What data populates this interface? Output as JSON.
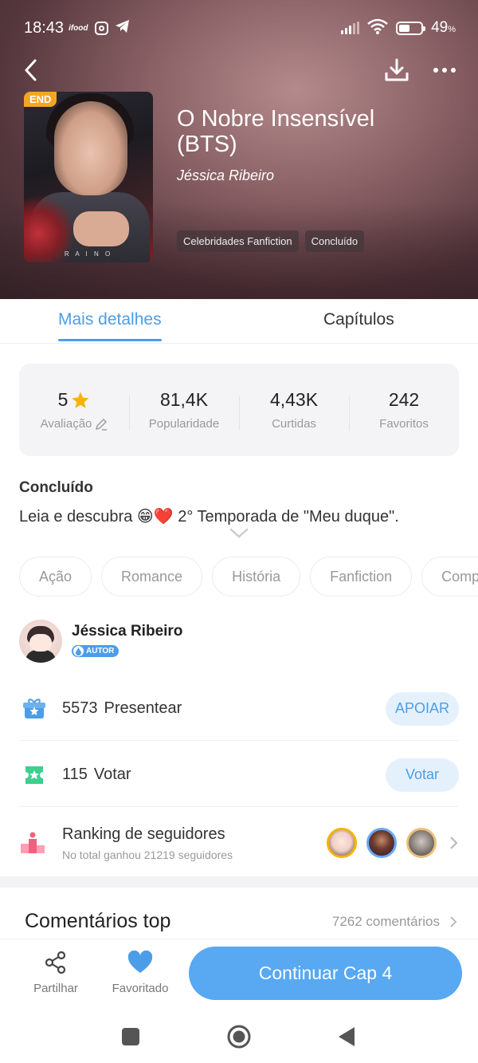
{
  "status_bar": {
    "time": "18:43",
    "app_indicator": "ifood",
    "battery_pct": "49",
    "battery_unit": "%",
    "battery_level": 0.49
  },
  "book": {
    "badge": "END",
    "cover_signature": "R A I N O",
    "title": "O Nobre Insensível (BTS)",
    "author": "Jéssica Ribeiro",
    "tags": [
      "Celebridades Fanfiction",
      "Concluído"
    ]
  },
  "tabs": {
    "details": "Mais detalhes",
    "chapters": "Capítulos"
  },
  "stats": {
    "rating_value": "5",
    "rating_label": "Avaliação",
    "popularity_value": "81,4K",
    "popularity_label": "Popularidade",
    "likes_value": "4,43K",
    "likes_label": "Curtidas",
    "favorites_value": "242",
    "favorites_label": "Favoritos"
  },
  "story": {
    "status": "Concluído",
    "description": "Leia e descubra 😁❤️ 2° Temporada de \"Meu duque\"."
  },
  "genres": [
    "Ação",
    "Romance",
    "História",
    "Fanfiction",
    "Comp"
  ],
  "author_block": {
    "name": "Jéssica Ribeiro",
    "badge": "AUTOR"
  },
  "gift": {
    "count": "5573",
    "label": "Presentear",
    "button": "APOIAR"
  },
  "vote": {
    "count": "115",
    "label": "Votar",
    "button": "Votar"
  },
  "ranking": {
    "title": "Ranking de seguidores",
    "subtitle": "No total ganhou 21219 seguidores"
  },
  "comments": {
    "title": "Comentários top",
    "count": "7262 comentários"
  },
  "bottom_bar": {
    "share": "Partilhar",
    "favorite": "Favoritado",
    "continue": "Continuar Cap 4"
  },
  "colors": {
    "accent": "#4c9de8",
    "button_bg": "#58a8f2",
    "star": "#f5b400",
    "gift": "#4c9de8",
    "ticket": "#3ccf8e",
    "rank": "#f06080"
  }
}
